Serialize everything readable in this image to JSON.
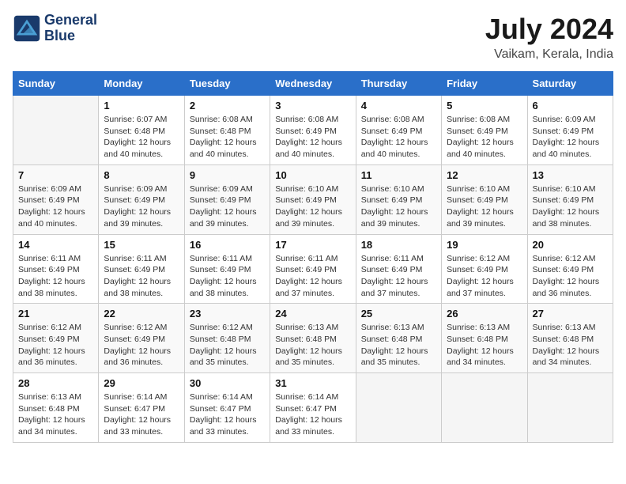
{
  "header": {
    "logo_line1": "General",
    "logo_line2": "Blue",
    "month": "July 2024",
    "location": "Vaikam, Kerala, India"
  },
  "weekdays": [
    "Sunday",
    "Monday",
    "Tuesday",
    "Wednesday",
    "Thursday",
    "Friday",
    "Saturday"
  ],
  "weeks": [
    [
      {
        "day": "",
        "info": ""
      },
      {
        "day": "1",
        "info": "Sunrise: 6:07 AM\nSunset: 6:48 PM\nDaylight: 12 hours and 40 minutes."
      },
      {
        "day": "2",
        "info": "Sunrise: 6:08 AM\nSunset: 6:48 PM\nDaylight: 12 hours and 40 minutes."
      },
      {
        "day": "3",
        "info": "Sunrise: 6:08 AM\nSunset: 6:49 PM\nDaylight: 12 hours and 40 minutes."
      },
      {
        "day": "4",
        "info": "Sunrise: 6:08 AM\nSunset: 6:49 PM\nDaylight: 12 hours and 40 minutes."
      },
      {
        "day": "5",
        "info": "Sunrise: 6:08 AM\nSunset: 6:49 PM\nDaylight: 12 hours and 40 minutes."
      },
      {
        "day": "6",
        "info": "Sunrise: 6:09 AM\nSunset: 6:49 PM\nDaylight: 12 hours and 40 minutes."
      }
    ],
    [
      {
        "day": "7",
        "info": "Sunrise: 6:09 AM\nSunset: 6:49 PM\nDaylight: 12 hours and 40 minutes."
      },
      {
        "day": "8",
        "info": "Sunrise: 6:09 AM\nSunset: 6:49 PM\nDaylight: 12 hours and 39 minutes."
      },
      {
        "day": "9",
        "info": "Sunrise: 6:09 AM\nSunset: 6:49 PM\nDaylight: 12 hours and 39 minutes."
      },
      {
        "day": "10",
        "info": "Sunrise: 6:10 AM\nSunset: 6:49 PM\nDaylight: 12 hours and 39 minutes."
      },
      {
        "day": "11",
        "info": "Sunrise: 6:10 AM\nSunset: 6:49 PM\nDaylight: 12 hours and 39 minutes."
      },
      {
        "day": "12",
        "info": "Sunrise: 6:10 AM\nSunset: 6:49 PM\nDaylight: 12 hours and 39 minutes."
      },
      {
        "day": "13",
        "info": "Sunrise: 6:10 AM\nSunset: 6:49 PM\nDaylight: 12 hours and 38 minutes."
      }
    ],
    [
      {
        "day": "14",
        "info": "Sunrise: 6:11 AM\nSunset: 6:49 PM\nDaylight: 12 hours and 38 minutes."
      },
      {
        "day": "15",
        "info": "Sunrise: 6:11 AM\nSunset: 6:49 PM\nDaylight: 12 hours and 38 minutes."
      },
      {
        "day": "16",
        "info": "Sunrise: 6:11 AM\nSunset: 6:49 PM\nDaylight: 12 hours and 38 minutes."
      },
      {
        "day": "17",
        "info": "Sunrise: 6:11 AM\nSunset: 6:49 PM\nDaylight: 12 hours and 37 minutes."
      },
      {
        "day": "18",
        "info": "Sunrise: 6:11 AM\nSunset: 6:49 PM\nDaylight: 12 hours and 37 minutes."
      },
      {
        "day": "19",
        "info": "Sunrise: 6:12 AM\nSunset: 6:49 PM\nDaylight: 12 hours and 37 minutes."
      },
      {
        "day": "20",
        "info": "Sunrise: 6:12 AM\nSunset: 6:49 PM\nDaylight: 12 hours and 36 minutes."
      }
    ],
    [
      {
        "day": "21",
        "info": "Sunrise: 6:12 AM\nSunset: 6:49 PM\nDaylight: 12 hours and 36 minutes."
      },
      {
        "day": "22",
        "info": "Sunrise: 6:12 AM\nSunset: 6:49 PM\nDaylight: 12 hours and 36 minutes."
      },
      {
        "day": "23",
        "info": "Sunrise: 6:12 AM\nSunset: 6:48 PM\nDaylight: 12 hours and 35 minutes."
      },
      {
        "day": "24",
        "info": "Sunrise: 6:13 AM\nSunset: 6:48 PM\nDaylight: 12 hours and 35 minutes."
      },
      {
        "day": "25",
        "info": "Sunrise: 6:13 AM\nSunset: 6:48 PM\nDaylight: 12 hours and 35 minutes."
      },
      {
        "day": "26",
        "info": "Sunrise: 6:13 AM\nSunset: 6:48 PM\nDaylight: 12 hours and 34 minutes."
      },
      {
        "day": "27",
        "info": "Sunrise: 6:13 AM\nSunset: 6:48 PM\nDaylight: 12 hours and 34 minutes."
      }
    ],
    [
      {
        "day": "28",
        "info": "Sunrise: 6:13 AM\nSunset: 6:48 PM\nDaylight: 12 hours and 34 minutes."
      },
      {
        "day": "29",
        "info": "Sunrise: 6:14 AM\nSunset: 6:47 PM\nDaylight: 12 hours and 33 minutes."
      },
      {
        "day": "30",
        "info": "Sunrise: 6:14 AM\nSunset: 6:47 PM\nDaylight: 12 hours and 33 minutes."
      },
      {
        "day": "31",
        "info": "Sunrise: 6:14 AM\nSunset: 6:47 PM\nDaylight: 12 hours and 33 minutes."
      },
      {
        "day": "",
        "info": ""
      },
      {
        "day": "",
        "info": ""
      },
      {
        "day": "",
        "info": ""
      }
    ]
  ]
}
